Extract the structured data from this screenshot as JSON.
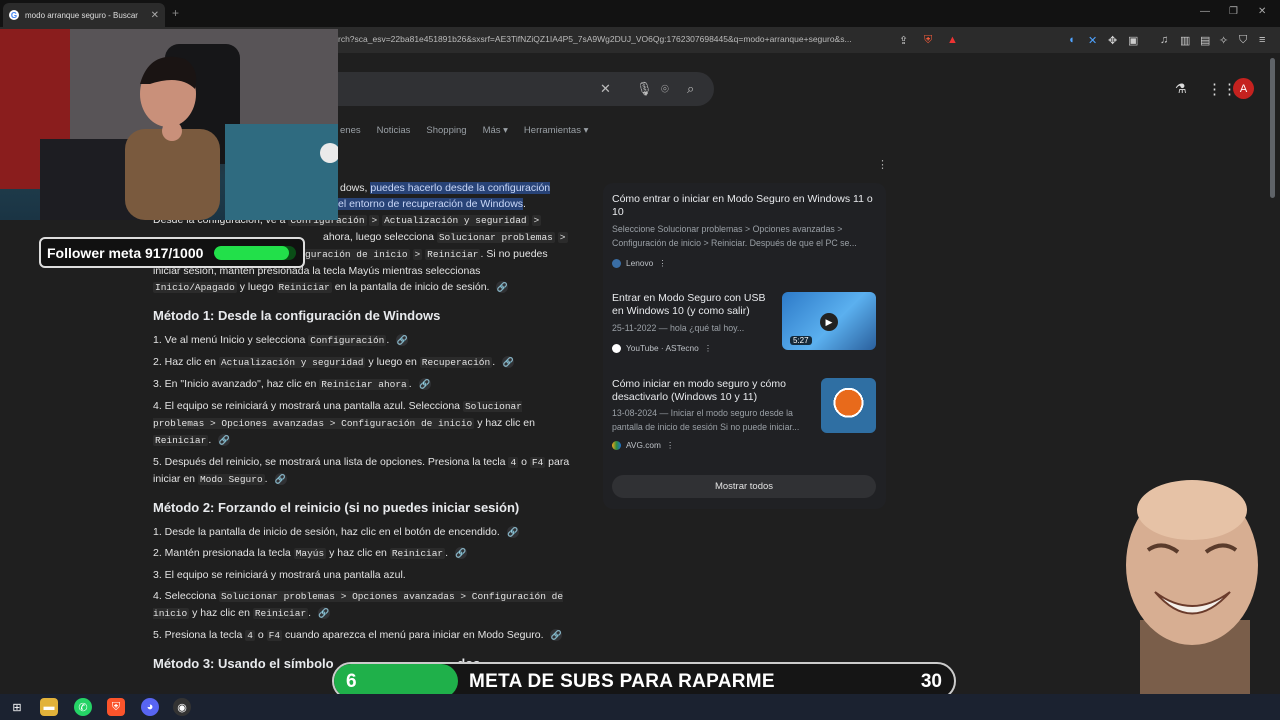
{
  "browser": {
    "tab_title": "modo arranque seguro - Buscar",
    "tab_close": "✕",
    "new_tab": "+",
    "url": "rch?sca_esv=22ba81e451891b26&sxsrf=AE3TifNZiQZ1IA4P5_7sA9Wg2DUJ_VO6Qg:1762307698445&q=modo+arranque+seguro&s..."
  },
  "google": {
    "tabs": [
      "enes",
      "Noticias",
      "Shopping",
      "Más ▾",
      "Herramientas ▾"
    ],
    "avatar_letter": "A"
  },
  "answer": {
    "intro_pre": "dows,",
    "intro_hl1": "puedes hacerlo desde la configuración",
    "intro_hl2": "el entorno de recuperación de Windows",
    "intro_post": ".",
    "line2_pre": "Desde la configuración, ve a",
    "code_config": "Configuración",
    "sep": ">",
    "code_update": "Actualización y seguridad",
    "line3_mid": "ahora",
    "line3_post": ", luego selecciona",
    "code_solve": "Solucionar problemas",
    "line4_code": "guración de inicio",
    "code_restart": "Reiniciar",
    "line4_post": ". Si no puedes",
    "line5": "iniciar sesión, mantén presionada la tecla Mayús mientras seleccionas",
    "code_power": "Inicio/Apagado",
    "line6_mid": "y luego",
    "line6_post": "en la pantalla de inicio de sesión.",
    "m1_title": "Método 1: Desde la configuración de Windows",
    "m1_items": {
      "s1_pre": "1. Ve al menú Inicio y selecciona",
      "s2_pre": "2. Haz clic en",
      "s2_mid": "y luego en",
      "code_recovery": "Recuperación",
      "s3_pre": "3. En \"Inicio avanzado\", haz clic en",
      "code_restart_now": "Reiniciar ahora",
      "s4_pre": "4. El equipo se reiniciará y mostrará una pantalla azul. Selecciona",
      "s4_code": "Solucionar problemas > Opciones avanzadas > Configuración de inicio",
      "s4_post": "y haz clic en",
      "s5_pre": "5. Después del reinicio, se mostrará una lista de opciones. Presiona la tecla",
      "code_4": "4",
      "s5_or": "o",
      "code_f4": "F4",
      "s5_post": "para iniciar en",
      "code_safe": "Modo Seguro"
    },
    "m2_title": "Método 2: Forzando el reinicio (si no puedes iniciar sesión)",
    "m2_items": {
      "s1": "1. Desde la pantalla de inicio de sesión, haz clic en el botón de encendido.",
      "s2_pre": "2. Mantén presionada la tecla",
      "code_shift": "Mayús",
      "s2_mid": "y haz clic en",
      "s3": "3. El equipo se reiniciará y mostrará una pantalla azul.",
      "s4_pre": "4. Selecciona",
      "s4_code": "Solucionar problemas > Opciones avanzadas > Configuración de inicio",
      "s4_post": "y haz clic en",
      "s5_pre": "5. Presiona la tecla",
      "s5_post": "cuando aparezca el menú para iniciar en Modo Seguro."
    },
    "m3_title": "Método 3: Usando el símbolo",
    "m3_tail": "dos"
  },
  "panel": {
    "cards": [
      {
        "title": "Cómo entrar o iniciar en Modo Seguro en Windows 11 o 10",
        "snippet": "Seleccione Solucionar problemas > Opciones avanzadas > Configuración de inicio > Reiniciar. Después de que el PC se...",
        "source": "Lenovo"
      },
      {
        "title": "Entrar en Modo Seguro con USB en Windows 10 (y como salir)",
        "snippet": "25-11-2022 — hola ¿qué tal hoy...",
        "source": "YouTube · ASTecno",
        "duration": "5:27"
      },
      {
        "title": "Cómo iniciar en modo seguro y cómo desactivarlo (Windows 10 y 11)",
        "snippet": "13-08-2024 — Iniciar el modo seguro desde la pantalla de inicio de sesión Si no puede iniciar...",
        "source": "AVG.com"
      }
    ],
    "show_all": "Mostrar todos"
  },
  "overlays": {
    "follower_label": "Follower meta 917/1000",
    "follower_progress": 0.917,
    "subs_current": "6",
    "subs_label": "META DE SUBS PARA RAPARME",
    "subs_goal": "30",
    "subs_progress": 0.2
  },
  "colors": {
    "accent": "#8ab4f8",
    "highlight": "#284377",
    "progress_green": "#22e04a",
    "avatar": "#c5221f"
  }
}
